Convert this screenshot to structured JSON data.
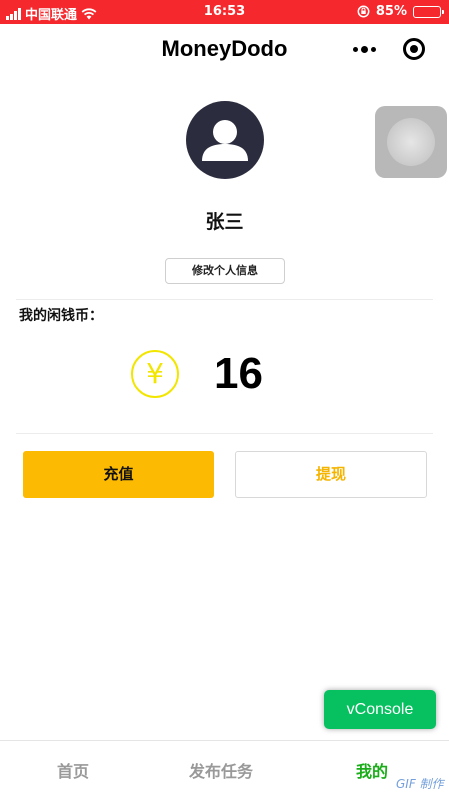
{
  "status_bar": {
    "carrier": "中国联通",
    "time": "16:53",
    "battery_percent": "85%",
    "battery_level": 0.85,
    "icons": [
      "signal-icon",
      "wifi-icon",
      "rotation-lock-icon",
      "battery-icon"
    ]
  },
  "nav": {
    "title": "MoneyDodo",
    "icons": [
      "more-icon",
      "target-icon"
    ]
  },
  "profile": {
    "name": "张三",
    "edit_label": "修改个人信息",
    "avatar_icon": "user-silhouette-icon"
  },
  "coins": {
    "label": "我的闲钱币：",
    "symbol": "¥",
    "value": "16"
  },
  "actions": {
    "recharge_label": "充值",
    "withdraw_label": "提现"
  },
  "vconsole_label": "vConsole",
  "tabs": [
    {
      "label": "首页",
      "active": false
    },
    {
      "label": "发布任务",
      "active": false
    },
    {
      "label": "我的",
      "active": true
    }
  ],
  "watermark": "GIF 制作",
  "colors": {
    "status_bar": "#f5282d",
    "recharge": "#fcba02",
    "withdraw_text": "#f5b400",
    "coin": "#f2e600",
    "tab_active": "#1aad19",
    "vconsole": "#07c160",
    "avatar_bg": "#2b2d3f"
  }
}
